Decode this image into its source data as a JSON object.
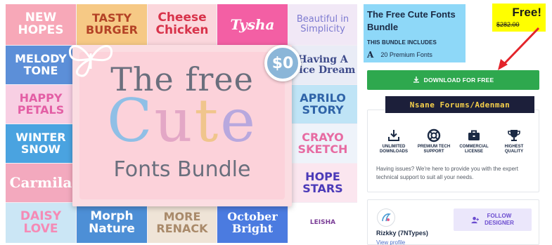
{
  "banner": {
    "price_badge": "$0",
    "hero": {
      "line1": "The free",
      "line2_letters": [
        "C",
        "u",
        "t",
        "e"
      ],
      "line3": "Fonts Bundle"
    },
    "tiles": [
      {
        "id": "new-hopes",
        "text": "NEW HOPES",
        "bg": "#f7a8b8",
        "fg": "#ffffff"
      },
      {
        "id": "tasty-burger",
        "text": "TASTY BURGER",
        "bg": "#f6c985",
        "fg": "#b44326"
      },
      {
        "id": "cheese-chicken",
        "text": "Cheese Chicken",
        "bg": "#fbd7dc",
        "fg": "#d8334a"
      },
      {
        "id": "tysha",
        "text": "Tysha",
        "bg": "#f35fa4",
        "fg": "#ffffff"
      },
      {
        "id": "beautiful-in-simplicity",
        "text": "Beautiful in Simplicity",
        "bg": "#f1e8f6",
        "fg": "#7d7ad0"
      },
      {
        "id": "melody-tone",
        "text": "MELODY TONE",
        "bg": "#5c8fd8",
        "fg": "#ffffff"
      },
      {
        "id": "having-a-nice-dream",
        "text": "Having A Nice Dream",
        "bg": "#e9ecf6",
        "fg": "#3d4a8a"
      },
      {
        "id": "happy-petals",
        "text": "HAPPY PETALS",
        "bg": "#f8cfe3",
        "fg": "#e35fa5"
      },
      {
        "id": "aprilo-story",
        "text": "APRILO STORY",
        "bg": "#bfe4f6",
        "fg": "#2f64a8"
      },
      {
        "id": "winter-snow",
        "text": "WINTER SNOW",
        "bg": "#4aa3e0",
        "fg": "#ffffff"
      },
      {
        "id": "crayo-sketch",
        "text": "CRAYO SKETCH",
        "bg": "#eef3fa",
        "fg": "#e76ba2"
      },
      {
        "id": "carmila",
        "text": "Carmila",
        "bg": "#f3a9be",
        "fg": "#ffffff"
      },
      {
        "id": "hope-stars",
        "text": "HOPE STARS",
        "bg": "#fbe6ef",
        "fg": "#4b3ab8"
      },
      {
        "id": "daisy-love",
        "text": "DAISY LOVE",
        "bg": "#cbe6f5",
        "fg": "#f58ab5"
      },
      {
        "id": "morph-nature",
        "text": "Morph Nature",
        "bg": "#4d8fd6",
        "fg": "#ffffff"
      },
      {
        "id": "more-renack",
        "text": "MORE RENACK",
        "bg": "#efe4d7",
        "fg": "#a98a6a"
      },
      {
        "id": "october-bright",
        "text": "October Bright",
        "bg": "#4b7be0",
        "fg": "#ffffff"
      },
      {
        "id": "monogram",
        "text": "LEISHA",
        "bg": "#ffffff",
        "fg": "#7a3d96"
      }
    ]
  },
  "product": {
    "title": "The Free Cute Fonts Bundle",
    "includes_label": "THIS BUNDLE INCLUDES",
    "includes_icon": "A",
    "includes_item": "20 Premium Fonts"
  },
  "pricing": {
    "free_label": "Free!",
    "old_price": "$282.00"
  },
  "download": {
    "label": "DOWNLOAD FOR FREE",
    "icon": "download-icon"
  },
  "watermark": {
    "text": "Nsane Forums/Adenman"
  },
  "support": {
    "features": [
      {
        "icon": "download-tray-icon",
        "label_line1": "UNLIMITED",
        "label_line2": "DOWNLOADS"
      },
      {
        "icon": "lifebuoy-icon",
        "label_line1": "PREMIUM TECH",
        "label_line2": "SUPPORT"
      },
      {
        "icon": "briefcase-icon",
        "label_line1": "COMMERCIAL",
        "label_line2": "LICENSE"
      },
      {
        "icon": "trophy-icon",
        "label_line1": "HIGHEST",
        "label_line2": "QUALITY"
      }
    ],
    "text": "Having issues? We're here to provide you with the expert technical support to suit all your needs."
  },
  "designer": {
    "name": "Rizkky (7NTypes)",
    "view_profile": "View profile",
    "follow_line1": "FOLLOW",
    "follow_line2": "DESIGNER"
  },
  "colors": {
    "title_box": "#8ed8f8",
    "free_box": "#ffff00",
    "download_button": "#2ea84e",
    "arrow": "#e3242b",
    "follow_bg": "#ebe7fb",
    "follow_fg": "#6b4ccf"
  }
}
